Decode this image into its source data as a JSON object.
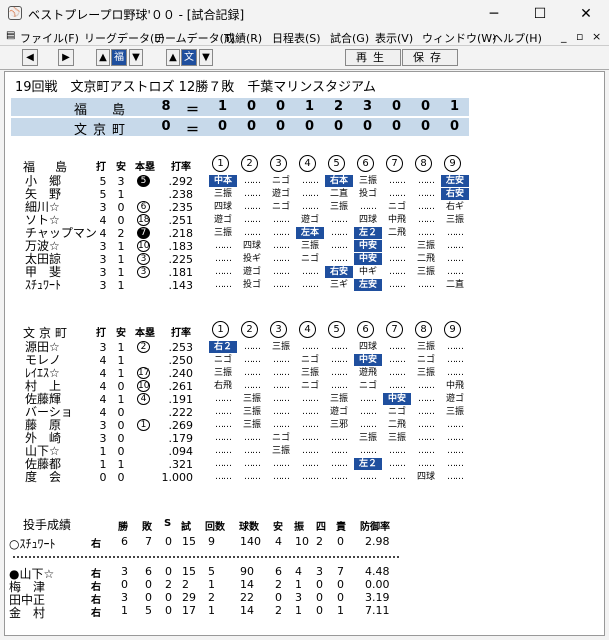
{
  "window": {
    "title": "ベストプレープロ野球'００ - [試合記録]",
    "min": "─",
    "max": "☐",
    "close": "✕"
  },
  "menu": [
    "ファイル(F)",
    "リーグデータ(L)",
    "チームデータ(T)",
    "成績(R)",
    "日程表(S)",
    "試合(G)",
    "表示(V)",
    "ウィンドウ(W)",
    "ヘルプ(H)"
  ],
  "menu_right": [
    "_",
    "▫",
    "×"
  ],
  "toolbar": {
    "prev": "◀",
    "next": "▶",
    "up1": "▲",
    "team1": "福",
    "down1": "▼",
    "up2": "▲",
    "team2": "文",
    "down2": "▼",
    "replay": "再生",
    "save": "保存"
  },
  "header": "19回戦　文京町アストロズ 12勝７敗　千葉マリンスタジアム",
  "linescore": [
    {
      "team": "福　島",
      "total": "8",
      "eq": "＝",
      "innings": [
        "1",
        "0",
        "0",
        "1",
        "2",
        "3",
        "0",
        "0",
        "1"
      ]
    },
    {
      "team": "文京町",
      "total": "0",
      "eq": "＝",
      "innings": [
        "0",
        "0",
        "0",
        "0",
        "0",
        "0",
        "0",
        "0",
        "0"
      ]
    }
  ],
  "batting_headers": {
    "h": "打",
    "a": "安",
    "hr": "本塁",
    "avg": "打率",
    "inn": [
      "1",
      "2",
      "3",
      "4",
      "5",
      "6",
      "7",
      "8",
      "9"
    ]
  },
  "teamA": {
    "name": "福　島",
    "players": [
      {
        "name": "小　郷",
        "ab": "5",
        "h": "3",
        "hr": "5",
        "hrblack": true,
        "avg": ".292",
        "res": [
          "中本",
          "",
          "ニゴ",
          "",
          "右本",
          "三振",
          "",
          "",
          "左安"
        ],
        "hi": [
          0,
          4,
          8
        ]
      },
      {
        "name": "矢　野",
        "ab": "5",
        "h": "1",
        "hr": "",
        "hrblack": false,
        "avg": ".238",
        "res": [
          "三振",
          "",
          "遊ゴ",
          "",
          "二直",
          "投ゴ",
          "",
          "",
          "右安"
        ],
        "hi": [
          8
        ]
      },
      {
        "name": "細川☆",
        "ab": "3",
        "h": "0",
        "hr": "6",
        "hrblack": false,
        "avg": ".235",
        "res": [
          "四球",
          "",
          "ニゴ",
          "",
          "三振",
          "",
          "ニゴ",
          "",
          "右ギ"
        ],
        "hi": []
      },
      {
        "name": "ソト☆",
        "ab": "4",
        "h": "0",
        "hr": "18",
        "hrblack": false,
        "avg": ".251",
        "res": [
          "遊ゴ",
          "",
          "",
          "遊ゴ",
          "",
          "四球",
          "中飛",
          "",
          "三振"
        ],
        "hi": []
      },
      {
        "name": "チャップマン",
        "ab": "4",
        "h": "2",
        "hr": "7",
        "hrblack": true,
        "avg": ".218",
        "res": [
          "三振",
          "",
          "",
          "左本",
          "",
          "左２",
          "二飛",
          "",
          ""
        ],
        "hi": [
          3,
          5
        ]
      },
      {
        "name": "万波☆",
        "ab": "3",
        "h": "1",
        "hr": "10",
        "hrblack": false,
        "avg": ".183",
        "res": [
          "",
          "四球",
          "",
          "三振",
          "",
          "中安",
          "",
          "三振",
          ""
        ],
        "hi": [
          5
        ]
      },
      {
        "name": "太田諒",
        "ab": "3",
        "h": "1",
        "hr": "3",
        "hrblack": false,
        "avg": ".225",
        "res": [
          "",
          "投ギ",
          "",
          "ニゴ",
          "",
          "中安",
          "",
          "二飛",
          ""
        ],
        "hi": [
          5
        ]
      },
      {
        "name": "甲　斐",
        "ab": "3",
        "h": "1",
        "hr": "3",
        "hrblack": false,
        "avg": ".181",
        "res": [
          "",
          "遊ゴ",
          "",
          "",
          "右安",
          "中ギ",
          "",
          "三振",
          ""
        ],
        "hi": [
          4
        ]
      },
      {
        "name": "ｽﾁｭﾜｰﾄ",
        "ab": "3",
        "h": "1",
        "hr": "",
        "hrblack": false,
        "avg": ".143",
        "res": [
          "",
          "投ゴ",
          "",
          "",
          "三ギ",
          "左安",
          "",
          "",
          "二直"
        ],
        "hi": [
          5
        ]
      }
    ]
  },
  "teamB": {
    "name": "文京町",
    "players": [
      {
        "name": "源田☆",
        "ab": "3",
        "h": "1",
        "hr": "2",
        "hrblack": false,
        "avg": ".253",
        "res": [
          "右２",
          "",
          "三振",
          "",
          "",
          "四球",
          "",
          "三振",
          ""
        ],
        "hi": [
          0
        ]
      },
      {
        "name": "モレノ",
        "ab": "4",
        "h": "1",
        "hr": "",
        "hrblack": false,
        "avg": ".250",
        "res": [
          "ニゴ",
          "",
          "",
          "ニゴ",
          "",
          "中安",
          "",
          "ニゴ",
          ""
        ],
        "hi": [
          5
        ]
      },
      {
        "name": "ﾚｲｴｽ☆",
        "ab": "4",
        "h": "1",
        "hr": "17",
        "hrblack": false,
        "avg": ".240",
        "res": [
          "三振",
          "",
          "",
          "三振",
          "",
          "遊飛",
          "",
          "三振",
          ""
        ],
        "hi": []
      },
      {
        "name": "村　上",
        "ab": "4",
        "h": "0",
        "hr": "10",
        "hrblack": false,
        "avg": ".261",
        "res": [
          "右飛",
          "",
          "",
          "ニゴ",
          "",
          "ニゴ",
          "",
          "",
          "中飛"
        ],
        "hi": []
      },
      {
        "name": "佐藤輝",
        "ab": "4",
        "h": "1",
        "hr": "4",
        "hrblack": false,
        "avg": ".191",
        "res": [
          "",
          "三振",
          "",
          "",
          "三振",
          "",
          "中安",
          "",
          "遊ゴ"
        ],
        "hi": [
          6
        ]
      },
      {
        "name": "バーショ",
        "ab": "4",
        "h": "0",
        "hr": "",
        "hrblack": false,
        "avg": ".222",
        "res": [
          "",
          "三振",
          "",
          "",
          "遊ゴ",
          "",
          "ニゴ",
          "",
          "三振"
        ],
        "hi": []
      },
      {
        "name": "藤　原",
        "ab": "3",
        "h": "0",
        "hr": "1",
        "hrblack": false,
        "avg": ".269",
        "res": [
          "",
          "三振",
          "",
          "",
          "三邪",
          "",
          "二飛",
          "",
          ""
        ],
        "hi": []
      },
      {
        "name": "外　崎",
        "ab": "3",
        "h": "0",
        "hr": "",
        "hrblack": false,
        "avg": ".179",
        "res": [
          "",
          "",
          "ニゴ",
          "",
          "",
          "三振",
          "三振",
          "",
          ""
        ],
        "hi": []
      },
      {
        "name": "山下☆",
        "ab": "1",
        "h": "0",
        "hr": "",
        "hrblack": false,
        "avg": ".094",
        "res": [
          "",
          "",
          "三振",
          "",
          "",
          "",
          "",
          "",
          ""
        ],
        "hi": []
      },
      {
        "name": "佐藤都",
        "ab": "1",
        "h": "1",
        "hr": "",
        "hrblack": false,
        "avg": ".321",
        "res": [
          "",
          "",
          "",
          "",
          "",
          "左２",
          "",
          "",
          ""
        ],
        "hi": [
          5
        ]
      },
      {
        "name": "度　会",
        "ab": "0",
        "h": "0",
        "hr": "",
        "hrblack": false,
        "avg": "1.000",
        "res": [
          "",
          "",
          "",
          "",
          "",
          "",
          "",
          "四球",
          ""
        ],
        "hi": []
      }
    ]
  },
  "pitching": {
    "title": "投手成績",
    "headers": [
      "勝",
      "敗",
      "S",
      "試",
      "回数",
      "球数",
      "安",
      "振",
      "四",
      "責",
      "防御率"
    ],
    "teamA": [
      {
        "name": "○ｽﾁｭﾜｰﾄ",
        "hand": "右",
        "vals": [
          "6",
          "7",
          "0",
          "15",
          "9",
          "140",
          "4",
          "10",
          "2",
          "0",
          "2.98"
        ]
      }
    ],
    "teamB": [
      {
        "name": "●山下☆",
        "hand": "右",
        "vals": [
          "3",
          "6",
          "0",
          "15",
          "5",
          "90",
          "6",
          "4",
          "3",
          "7",
          "4.48"
        ]
      },
      {
        "name": "梅　津",
        "hand": "右",
        "vals": [
          "0",
          "0",
          "2",
          "2",
          "1",
          "14",
          "2",
          "1",
          "0",
          "0",
          "0.00"
        ]
      },
      {
        "name": "田中正",
        "hand": "右",
        "vals": [
          "3",
          "0",
          "0",
          "29",
          "2",
          "22",
          "0",
          "3",
          "0",
          "0",
          "3.19"
        ]
      },
      {
        "name": "金　村",
        "hand": "右",
        "vals": [
          "1",
          "5",
          "0",
          "17",
          "1",
          "14",
          "2",
          "1",
          "0",
          "1",
          "7.11"
        ]
      }
    ]
  }
}
